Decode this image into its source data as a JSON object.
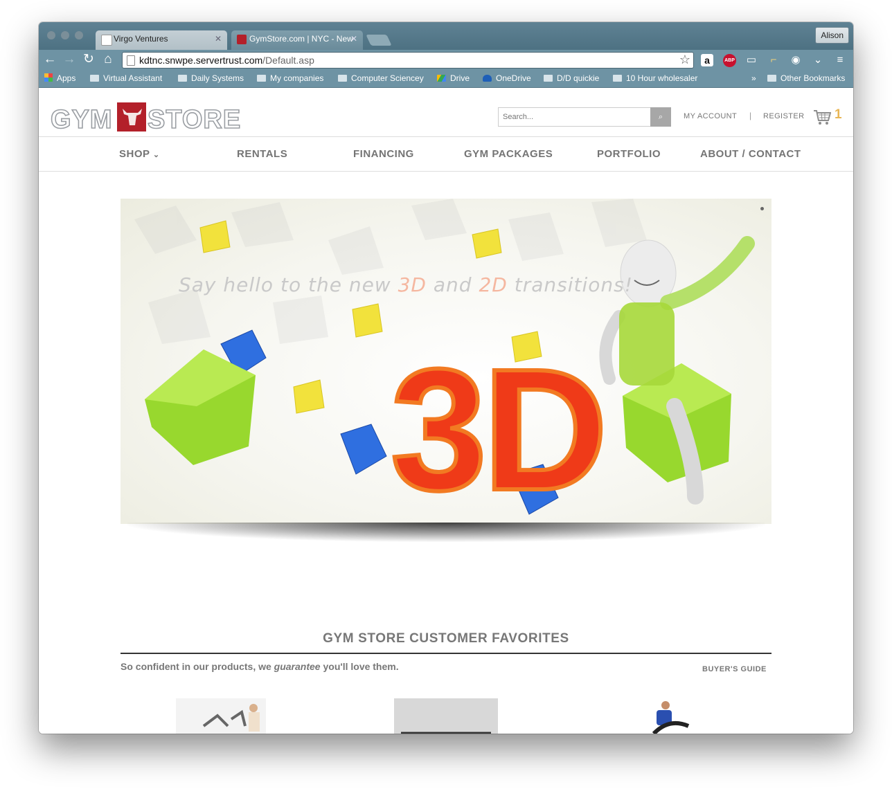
{
  "browser": {
    "tabs": [
      {
        "label": "Virgo Ventures",
        "active": false
      },
      {
        "label": "GymStore.com | NYC - New",
        "active": true
      }
    ],
    "profile_label": "Alison",
    "url_host": "kdtnc.snwpe.servertrust.com",
    "url_path": "/Default.asp",
    "bookmarks": [
      {
        "label": "Apps",
        "icon": "apps-grid-icon"
      },
      {
        "label": "Virtual Assistant",
        "icon": "folder-icon"
      },
      {
        "label": "Daily Systems",
        "icon": "folder-icon"
      },
      {
        "label": "My companies",
        "icon": "folder-icon"
      },
      {
        "label": "Computer Sciencey",
        "icon": "folder-icon"
      },
      {
        "label": "Drive",
        "icon": "google-drive-icon"
      },
      {
        "label": "OneDrive",
        "icon": "onedrive-icon"
      },
      {
        "label": "D/D quickie",
        "icon": "folder-icon"
      },
      {
        "label": "10 Hour wholesaler",
        "icon": "folder-icon"
      }
    ],
    "bookmarks_overflow": "»",
    "other_bookmarks": "Other Bookmarks"
  },
  "site": {
    "logo_left": "GYM",
    "logo_right": "STORE",
    "search_placeholder": "Search...",
    "my_account": "MY ACCOUNT",
    "separator": "|",
    "register": "REGISTER",
    "cart_count": "1",
    "nav": [
      {
        "label": "SHOP",
        "has_dropdown": true
      },
      {
        "label": "RENTALS"
      },
      {
        "label": "FINANCING"
      },
      {
        "label": "GYM PACKAGES"
      },
      {
        "label": "PORTFOLIO"
      },
      {
        "label": "ABOUT / CONTACT"
      }
    ],
    "shop_caret": "⌄",
    "hero": {
      "tagline_1": "Say hello to the new ",
      "tagline_3d": "3D",
      "tagline_2": " and ",
      "tagline_2d": "2D",
      "tagline_3": " transitions!",
      "big_text": "3D"
    },
    "favorites": {
      "title": "GYM STORE CUSTOMER FAVORITES",
      "subtitle_pre": "So confident in our products, we ",
      "subtitle_em": "guarantee",
      "subtitle_post": " you'll love them.",
      "buyers_guide": "BUYER'S GUIDE"
    }
  },
  "colors": {
    "brand_red": "#b3202a",
    "cart_count": "#e8b655",
    "nav_text": "#747474"
  }
}
